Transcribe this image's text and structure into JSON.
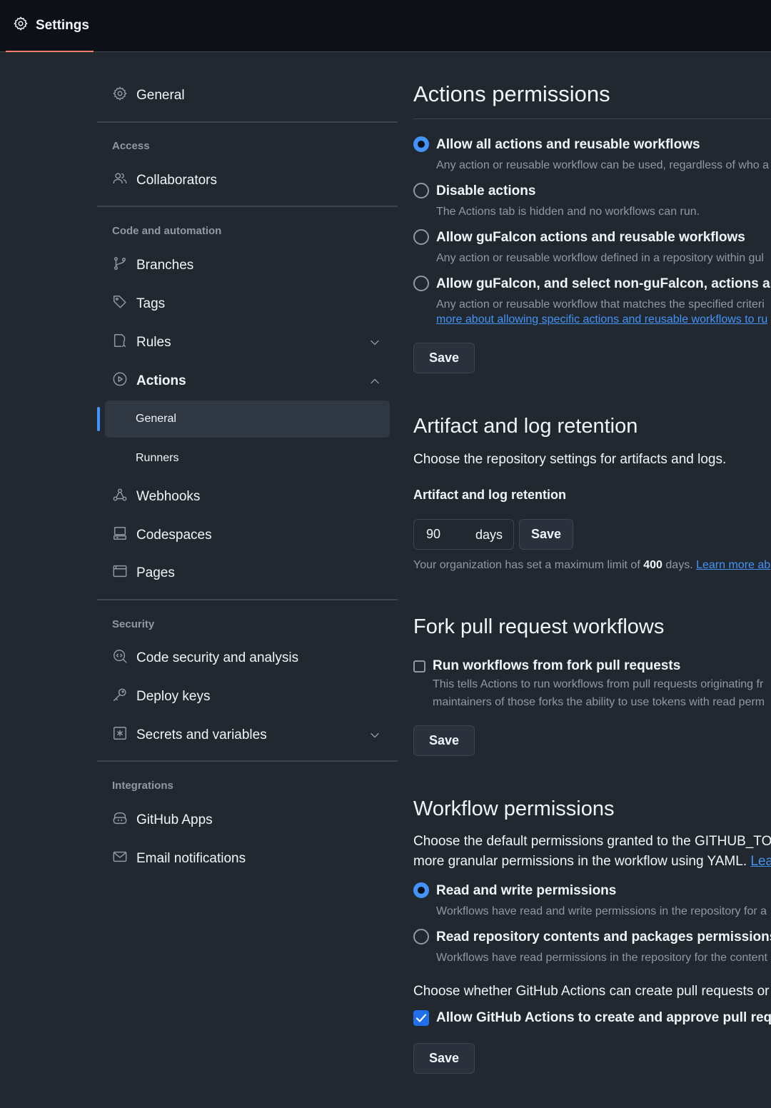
{
  "topbar": {
    "tab_label": "Settings"
  },
  "sidebar": {
    "general": "General",
    "groups": {
      "access": "Access",
      "code_automation": "Code and automation",
      "security": "Security",
      "integrations": "Integrations"
    },
    "items": {
      "collaborators": "Collaborators",
      "branches": "Branches",
      "tags": "Tags",
      "rules": "Rules",
      "actions": "Actions",
      "actions_general": "General",
      "actions_runners": "Runners",
      "webhooks": "Webhooks",
      "codespaces": "Codespaces",
      "pages": "Pages",
      "code_security": "Code security and analysis",
      "deploy_keys": "Deploy keys",
      "secrets": "Secrets and variables",
      "github_apps": "GitHub Apps",
      "email_notifications": "Email notifications"
    }
  },
  "actions_permissions": {
    "title": "Actions permissions",
    "options": [
      {
        "label": "Allow all actions and reusable workflows",
        "desc": "Any action or reusable workflow can be used, regardless of who a",
        "checked": true
      },
      {
        "label": "Disable actions",
        "desc": "The Actions tab is hidden and no workflows can run.",
        "checked": false
      },
      {
        "label": "Allow guFalcon actions and reusable workflows",
        "desc": "Any action or reusable workflow defined in a repository within gul",
        "checked": false
      },
      {
        "label": "Allow guFalcon, and select non-guFalcon, actions and r",
        "desc": "Any action or reusable workflow that matches the specified criteri",
        "checked": false
      }
    ],
    "option4_link": "more about allowing specific actions and reusable workflows to ru",
    "save_label": "Save"
  },
  "artifact": {
    "title": "Artifact and log retention",
    "desc": "Choose the repository settings for artifacts and logs.",
    "field_label": "Artifact and log retention",
    "days_value": "90",
    "days_suffix": "days",
    "save_label": "Save",
    "note_prefix": "Your organization has set a maximum limit of",
    "note_limit": "400",
    "note_suffix": "days.",
    "note_link": "Learn more ab"
  },
  "fork_pr": {
    "title": "Fork pull request workflows",
    "checkbox_label": "Run workflows from fork pull requests",
    "desc_line1": "This tells Actions to run workflows from pull requests originating fr",
    "desc_line2": "maintainers of those forks the ability to use tokens with read perm",
    "checked": false,
    "save_label": "Save"
  },
  "workflow_permissions": {
    "title": "Workflow permissions",
    "desc_line1": "Choose the default permissions granted to the GITHUB_TOK",
    "desc_line2": "more granular permissions in the workflow using YAML.",
    "desc_link": "Lear",
    "options": [
      {
        "label": "Read and write permissions",
        "desc": "Workflows have read and write permissions in the repository for a",
        "checked": true
      },
      {
        "label": "Read repository contents and packages permissions",
        "desc": "Workflows have read permissions in the repository for the content",
        "checked": false
      }
    ],
    "pr_question": "Choose whether GitHub Actions can create pull requests or s",
    "pr_checkbox_label": "Allow GitHub Actions to create and approve pull reque",
    "pr_checked": true,
    "save_label": "Save"
  },
  "colors": {
    "background": "#212830",
    "topbar": "#0d1117",
    "accent_blue": "#4493f8",
    "tab_underline": "#f78166",
    "muted_text": "#9198a1",
    "border": "#3d444d"
  }
}
